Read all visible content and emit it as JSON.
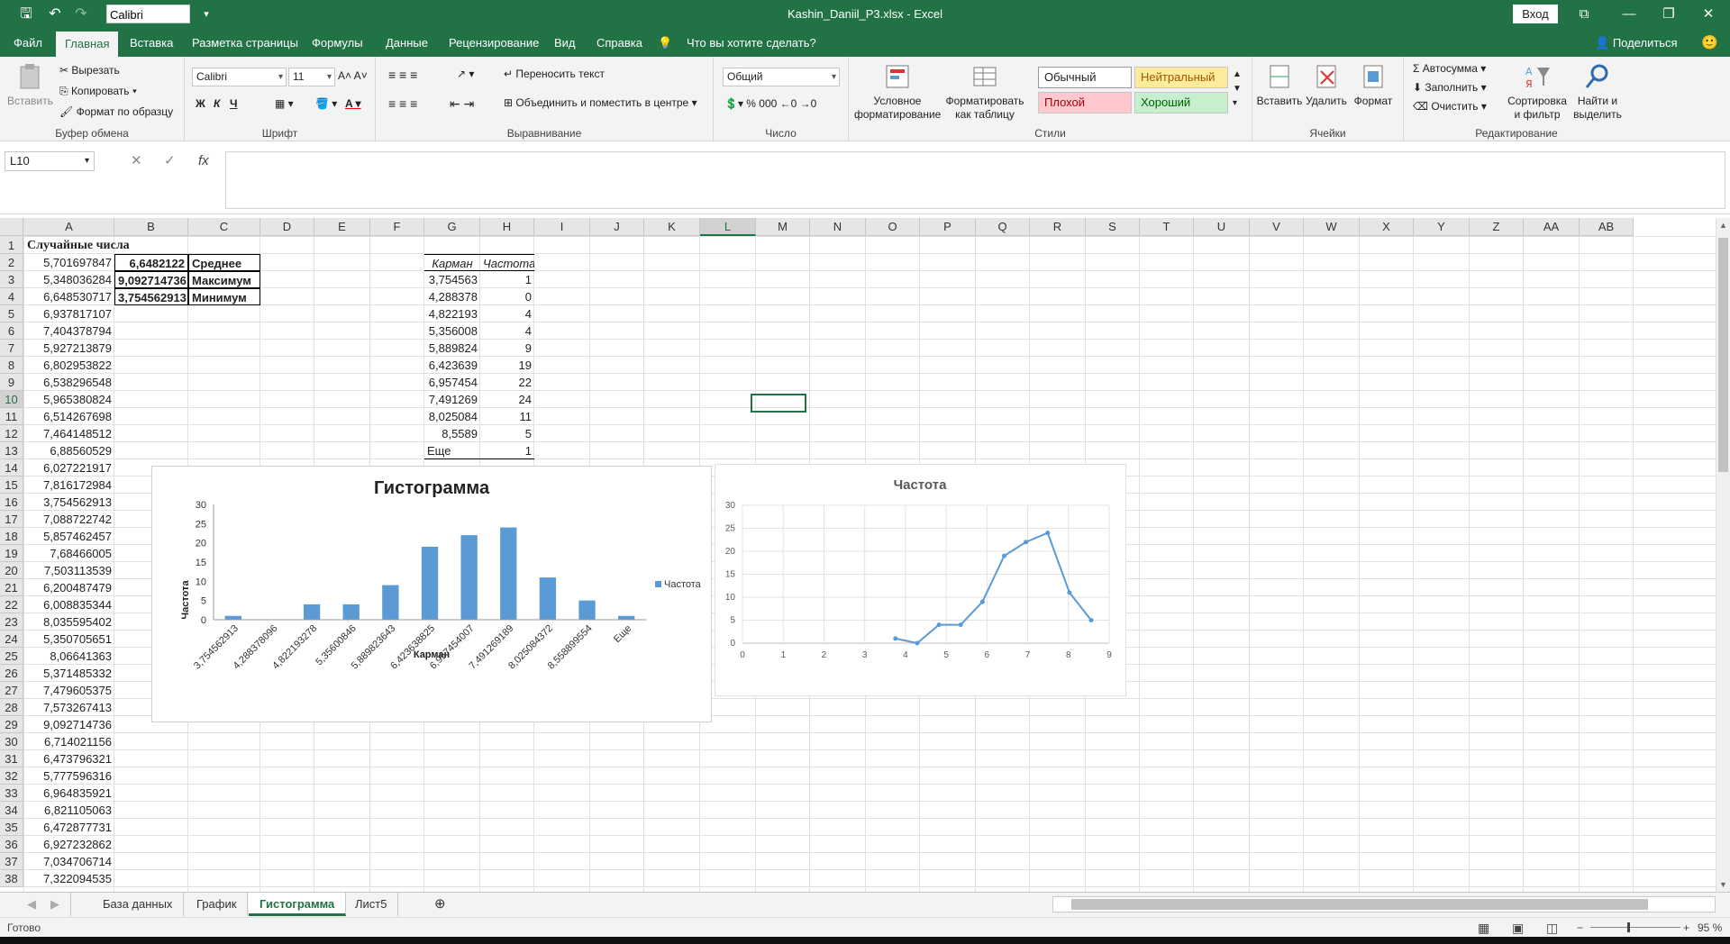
{
  "titlebar": {
    "font_name": "Calibri",
    "title": "Kashin_Daniil_P3.xlsx  -  Excel",
    "signin": "Вход"
  },
  "ribbon_tabs": [
    "Файл",
    "Главная",
    "Вставка",
    "Разметка страницы",
    "Формулы",
    "Данные",
    "Рецензирование",
    "Вид",
    "Справка",
    "Что вы хотите сделать?"
  ],
  "share": "Поделиться",
  "ribbon": {
    "clipboard": {
      "paste": "Вставить",
      "cut": "Вырезать",
      "copy": "Копировать",
      "format_painter": "Формат по образцу",
      "label": "Буфер обмена"
    },
    "font": {
      "name": "Calibri",
      "size": "11",
      "label": "Шрифт",
      "bold": "Ж",
      "italic": "К",
      "underline": "Ч"
    },
    "alignment": {
      "wrap": "Переносить текст",
      "merge": "Объединить и поместить в центре",
      "label": "Выравнивание"
    },
    "number": {
      "format": "Общий",
      "label": "Число"
    },
    "styles": {
      "conditional": "Условное форматирование",
      "as_table": "Форматировать как таблицу",
      "normal": "Обычный",
      "neutral": "Нейтральный",
      "bad": "Плохой",
      "good": "Хороший",
      "label": "Стили"
    },
    "cells": {
      "insert": "Вставить",
      "delete": "Удалить",
      "format": "Формат",
      "label": "Ячейки"
    },
    "editing": {
      "autosum": "Автосумма",
      "fill": "Заполнить",
      "clear": "Очистить",
      "sort": "Сортировка и фильтр",
      "find": "Найти и выделить",
      "label": "Редактирование"
    }
  },
  "namebox": "L10",
  "columns": [
    "A",
    "B",
    "C",
    "D",
    "E",
    "F",
    "G",
    "H",
    "I",
    "J",
    "K",
    "L",
    "M",
    "N",
    "O",
    "P",
    "Q",
    "R",
    "S",
    "T",
    "U",
    "V",
    "W",
    "X",
    "Y",
    "Z",
    "AA",
    "AB"
  ],
  "rows": [
    "1",
    "2",
    "3",
    "4",
    "5",
    "6",
    "7",
    "8",
    "9",
    "10",
    "11",
    "12",
    "13",
    "14",
    "15",
    "16",
    "17",
    "18",
    "19",
    "20",
    "21",
    "22",
    "23",
    "24",
    "25",
    "26",
    "27",
    "28",
    "29",
    "30",
    "31",
    "32",
    "33",
    "34",
    "35",
    "36",
    "37",
    "38"
  ],
  "col_a_header": "Случайные числа",
  "col_a": [
    "5,701697847",
    "5,348036284",
    "6,648530717",
    "6,937817107",
    "7,404378794",
    "5,927213879",
    "6,802953822",
    "6,538296548",
    "5,965380824",
    "6,514267698",
    "7,464148512",
    "6,88560529",
    "6,027221917",
    "7,816172984",
    "3,754562913",
    "7,088722742",
    "5,857462457",
    "7,68466005",
    "7,503113539",
    "6,200487479",
    "6,008835344",
    "8,035595402",
    "5,350705651",
    "8,06641363",
    "5,371485332",
    "7,479605375",
    "7,573267413",
    "9,092714736",
    "6,714021156",
    "6,473796321",
    "5,777596316",
    "6,964835921",
    "6,821105063",
    "6,472877731",
    "6,927232862",
    "7,034706714",
    "7,322094535"
  ],
  "stats": [
    {
      "value": "6,6482122",
      "label": "Среднее"
    },
    {
      "value": "9,092714736",
      "label": "Максимум"
    },
    {
      "value": "3,754562913",
      "label": "Минимум"
    }
  ],
  "freq_table": {
    "headers": [
      "Карман",
      "Частота"
    ],
    "rows": [
      [
        "3,754563",
        "1"
      ],
      [
        "4,288378",
        "0"
      ],
      [
        "4,822193",
        "4"
      ],
      [
        "5,356008",
        "4"
      ],
      [
        "5,889824",
        "9"
      ],
      [
        "6,423639",
        "19"
      ],
      [
        "6,957454",
        "22"
      ],
      [
        "7,491269",
        "24"
      ],
      [
        "8,025084",
        "11"
      ],
      [
        "8,5589",
        "5"
      ],
      [
        "Еще",
        "1"
      ]
    ]
  },
  "chart_data": [
    {
      "type": "bar",
      "title": "Гистограмма",
      "xlabel": "Карман",
      "ylabel": "Частота",
      "categories": [
        "3,754562913",
        "4,288378096",
        "4,822193278",
        "5,35600846",
        "5,889823643",
        "6,423638825",
        "6,957454007",
        "7,491269189",
        "8,025084372",
        "8,558899554",
        "Еще"
      ],
      "series": [
        {
          "name": "Частота",
          "values": [
            1,
            0,
            4,
            4,
            9,
            19,
            22,
            24,
            11,
            5,
            1
          ]
        }
      ],
      "ylim": [
        0,
        30
      ],
      "yticks": [
        "0",
        "5",
        "10",
        "15",
        "20",
        "25",
        "30"
      ],
      "legend": "right",
      "color": "#5b9bd5"
    },
    {
      "type": "scatter",
      "title": "Частота",
      "x": [
        3.754563,
        4.288378,
        4.822193,
        5.356008,
        5.889824,
        6.423639,
        6.957454,
        7.491269,
        8.025084,
        8.5589
      ],
      "y": [
        1,
        0,
        4,
        4,
        9,
        19,
        22,
        24,
        11,
        5
      ],
      "xlim": [
        0,
        9
      ],
      "ylim": [
        0,
        30
      ],
      "xticks": [
        "0",
        "1",
        "2",
        "3",
        "4",
        "5",
        "6",
        "7",
        "8",
        "9"
      ],
      "yticks": [
        "0",
        "5",
        "10",
        "15",
        "20",
        "25",
        "30"
      ],
      "grid": true,
      "color": "#5b9bd5"
    }
  ],
  "sheet_tabs": [
    "База данных",
    "График",
    "Гистограмма",
    "Лист5"
  ],
  "active_sheet": "Гистограмма",
  "status": {
    "ready": "Готово",
    "zoom": "95 %"
  }
}
